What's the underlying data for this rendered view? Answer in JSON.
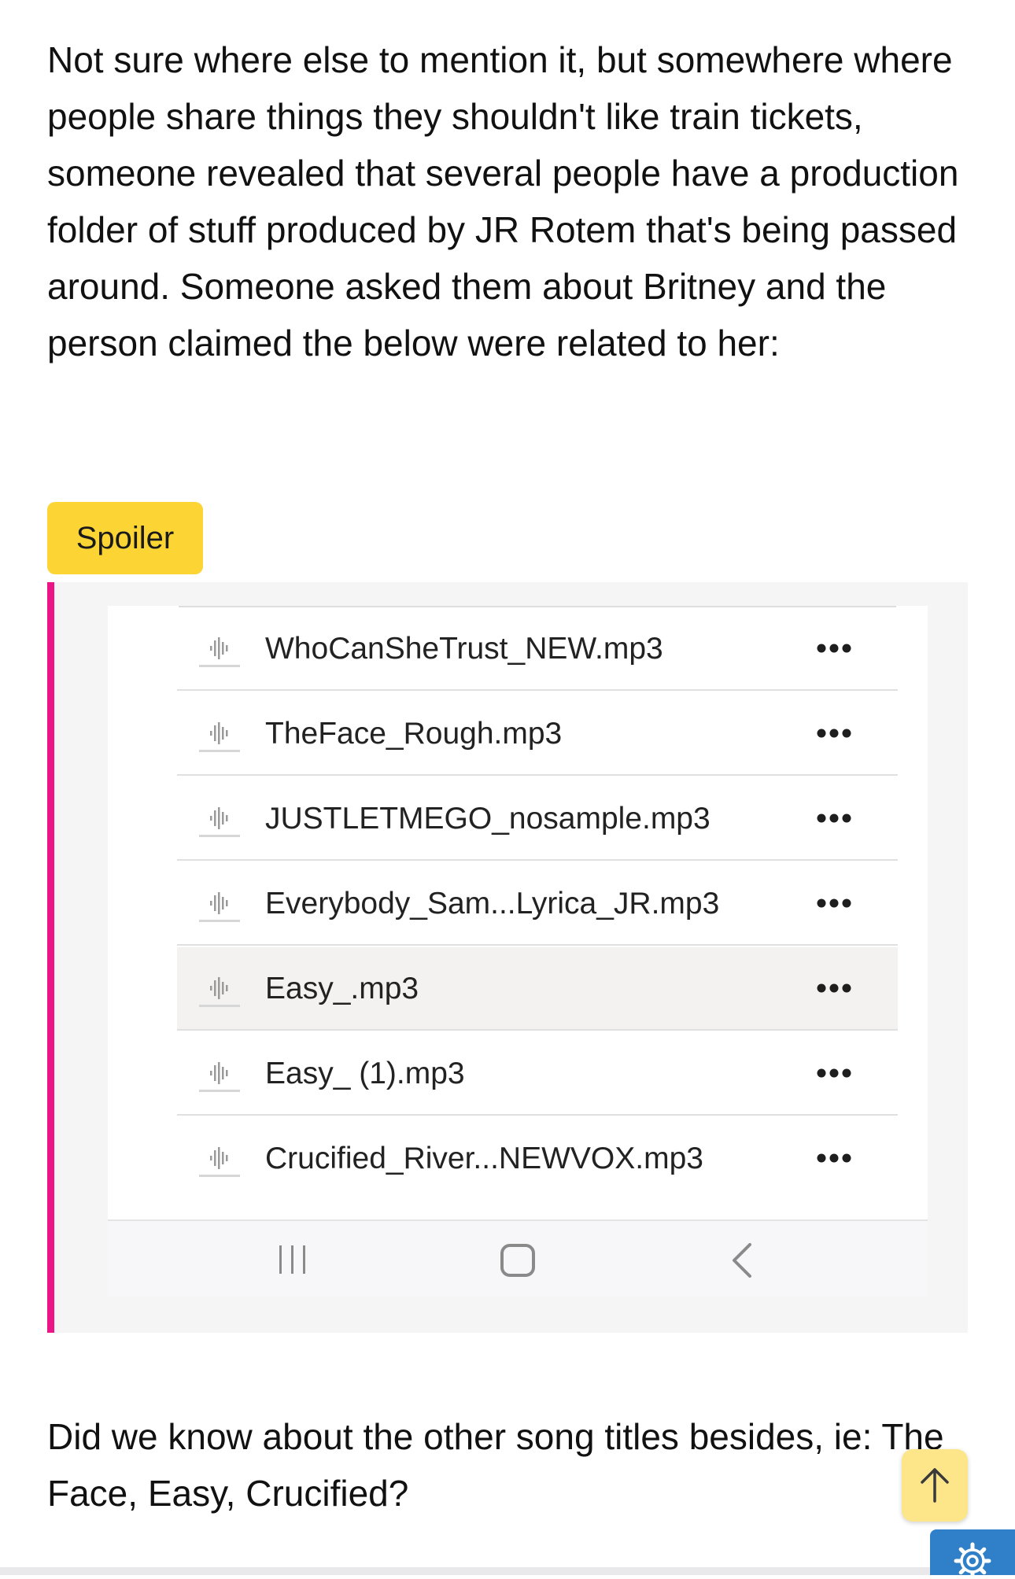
{
  "post": {
    "intro_text": "Not sure where else to mention it, but somewhere where people share things they shouldn't like train tickets, someone revealed that several people have a production folder of stuff produced by JR Rotem that's being passed around. Someone asked them about Britney and the person claimed the below were related to her:",
    "question_text": "Did we know about the other song titles besides, ie: The Face, Easy, Crucified?"
  },
  "spoiler": {
    "label": "Spoiler",
    "button_color": "#fcd535",
    "border_color": "#ec1587"
  },
  "file_list": {
    "files": [
      {
        "name": "WhoCanSheTrust_NEW.mp3",
        "icon": "audio-file-icon",
        "highlighted": false
      },
      {
        "name": "TheFace_Rough.mp3",
        "icon": "audio-file-icon",
        "highlighted": false
      },
      {
        "name": "JUSTLETMEGO_nosample.mp3",
        "icon": "audio-file-icon",
        "highlighted": false
      },
      {
        "name": "Everybody_Sam...Lyrica_JR.mp3",
        "icon": "audio-file-icon",
        "highlighted": false
      },
      {
        "name": "Easy_.mp3",
        "icon": "audio-file-icon",
        "highlighted": true
      },
      {
        "name": "Easy_ (1).mp3",
        "icon": "audio-file-icon",
        "highlighted": false
      },
      {
        "name": "Crucified_River...NEWVOX.mp3",
        "icon": "audio-file-icon",
        "highlighted": false
      }
    ],
    "row_menu_icon": "more-horizontal-icon"
  },
  "phone_nav": {
    "icons": [
      "recent-apps-icon",
      "home-icon",
      "back-icon"
    ]
  },
  "floating": {
    "scroll_top_icon": "arrow-up-icon",
    "settings_icon": "gear-icon",
    "scroll_top_color": "#fde68a",
    "settings_color": "#2f80c9"
  }
}
